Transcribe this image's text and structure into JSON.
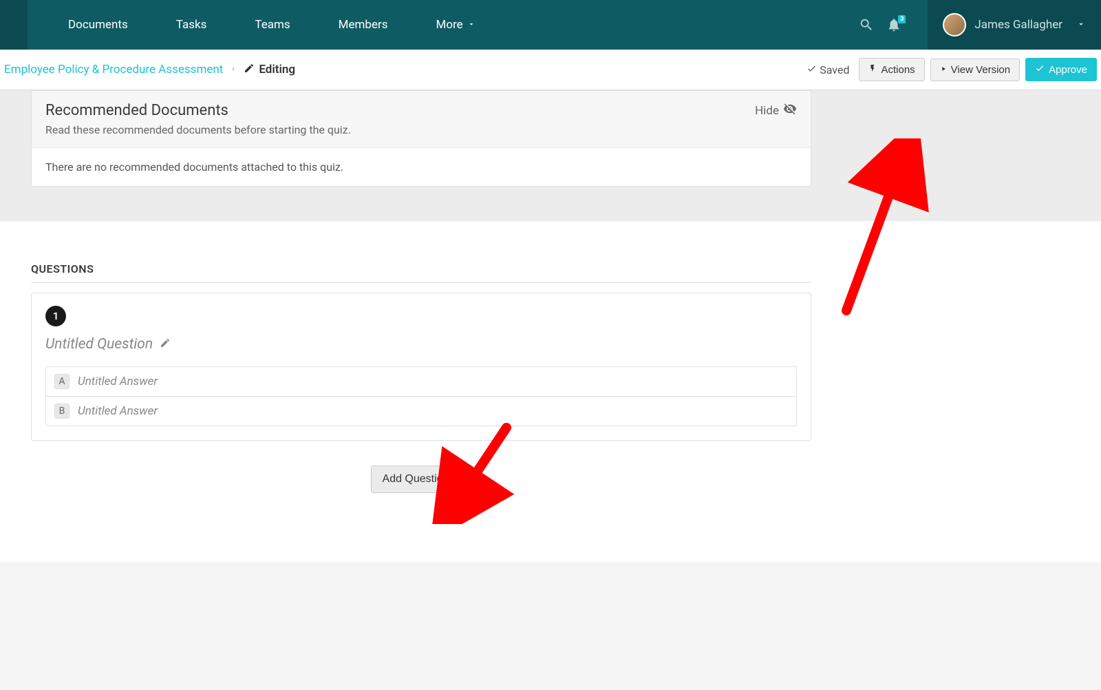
{
  "nav": {
    "documents": "Documents",
    "tasks": "Tasks",
    "teams": "Teams",
    "members": "Members",
    "more": "More"
  },
  "user": {
    "name": "James Gallagher",
    "notif_count": "3"
  },
  "breadcrumb": {
    "link": "Employee Policy & Procedure Assessment",
    "editing": "Editing"
  },
  "status": {
    "saved": "Saved"
  },
  "actions": {
    "actions": "Actions",
    "view_version": "View Version",
    "approve": "Approve"
  },
  "recommended": {
    "title": "Recommended Documents",
    "subtitle": "Read these recommended documents before starting the quiz.",
    "hide": "Hide",
    "empty": "There are no recommended documents attached to this quiz."
  },
  "questions": {
    "heading": "QUESTIONS",
    "items": [
      {
        "number": "1",
        "title": "Untitled Question",
        "answers": [
          {
            "letter": "A",
            "text": "Untitled Answer"
          },
          {
            "letter": "B",
            "text": "Untitled Answer"
          }
        ]
      }
    ],
    "add_button": "Add Question"
  }
}
